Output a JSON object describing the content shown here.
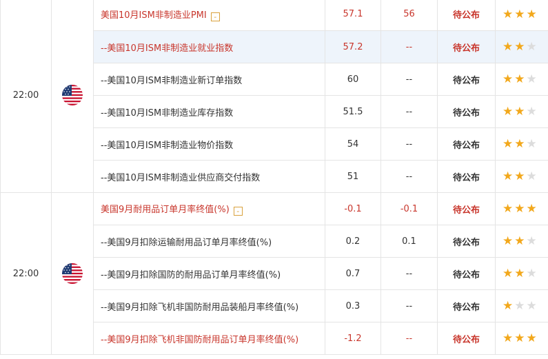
{
  "colors": {
    "accent_red": "#c8352b",
    "star_on": "#f2a81c",
    "star_off": "#dcdcdc",
    "highlight_row": "#eef4fb"
  },
  "groups": [
    {
      "time": "22:00",
      "flag": "us-flag-icon",
      "rows": [
        {
          "name": "美国10月ISM非制造业PMI",
          "actual": "57.1",
          "previous": "56",
          "status": "待公布",
          "stars": 3,
          "red": true,
          "toggle": "-"
        },
        {
          "name": "--美国10月ISM非制造业就业指数",
          "actual": "57.2",
          "previous": "--",
          "status": "待公布",
          "stars": 2,
          "red": true,
          "highlight": true
        },
        {
          "name": "--美国10月ISM非制造业新订单指数",
          "actual": "60",
          "previous": "--",
          "status": "待公布",
          "stars": 2
        },
        {
          "name": "--美国10月ISM非制造业库存指数",
          "actual": "51.5",
          "previous": "--",
          "status": "待公布",
          "stars": 2
        },
        {
          "name": "--美国10月ISM非制造业物价指数",
          "actual": "54",
          "previous": "--",
          "status": "待公布",
          "stars": 2
        },
        {
          "name": "--美国10月ISM非制造业供应商交付指数",
          "actual": "51",
          "previous": "--",
          "status": "待公布",
          "stars": 2
        }
      ]
    },
    {
      "time": "22:00",
      "flag": "us-flag-icon",
      "rows": [
        {
          "name": "美国9月耐用品订单月率终值(%)",
          "actual": "-0.1",
          "previous": "-0.1",
          "status": "待公布",
          "stars": 3,
          "red": true,
          "toggle": "-"
        },
        {
          "name": "--美国9月扣除运输耐用品订单月率终值(%)",
          "actual": "0.2",
          "previous": "0.1",
          "status": "待公布",
          "stars": 2
        },
        {
          "name": "--美国9月扣除国防的耐用品订单月率终值(%)",
          "actual": "0.7",
          "previous": "--",
          "status": "待公布",
          "stars": 2
        },
        {
          "name": "--美国9月扣除飞机非国防耐用品装船月率终值(%)",
          "actual": "0.3",
          "previous": "--",
          "status": "待公布",
          "stars": 1
        },
        {
          "name": "--美国9月扣除飞机非国防耐用品订单月率终值(%)",
          "actual": "-1.2",
          "previous": "--",
          "status": "待公布",
          "stars": 3,
          "red": true
        }
      ]
    }
  ]
}
